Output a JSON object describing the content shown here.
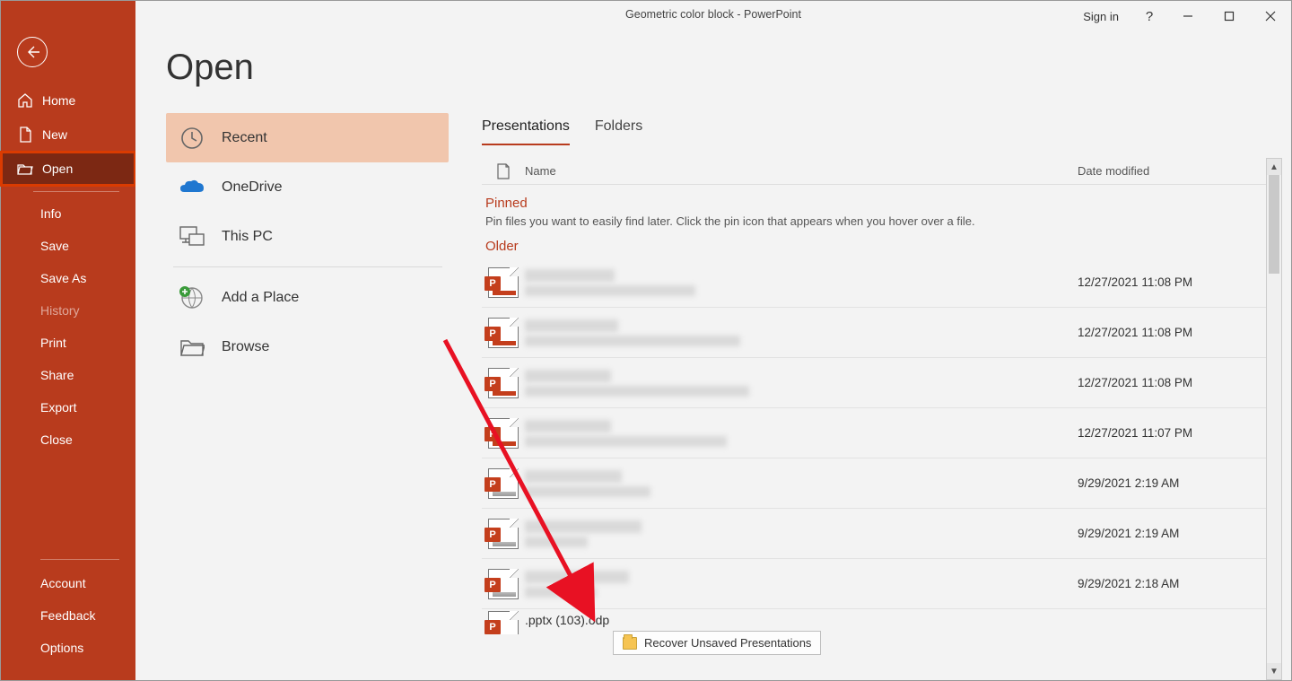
{
  "window": {
    "title": "Geometric color block  -  PowerPoint",
    "sign_in": "Sign in"
  },
  "page": {
    "title": "Open"
  },
  "sidebar": {
    "home": "Home",
    "new": "New",
    "open": "Open",
    "info": "Info",
    "save": "Save",
    "save_as": "Save As",
    "history": "History",
    "print": "Print",
    "share": "Share",
    "export": "Export",
    "close": "Close",
    "account": "Account",
    "feedback": "Feedback",
    "options": "Options"
  },
  "places": {
    "recent": "Recent",
    "onedrive": "OneDrive",
    "this_pc": "This PC",
    "add_place": "Add a Place",
    "browse": "Browse"
  },
  "tabs": {
    "presentations": "Presentations",
    "folders": "Folders"
  },
  "list_header": {
    "name": "Name",
    "date": "Date modified"
  },
  "pinned": {
    "heading": "Pinned",
    "hint": "Pin files you want to easily find later. Click the pin icon that appears when you hover over a file."
  },
  "older": {
    "heading": "Older",
    "files": [
      {
        "date": "12/27/2021 11:08 PM",
        "w1": 100,
        "w2": 190,
        "variant": "red"
      },
      {
        "date": "12/27/2021 11:08 PM",
        "w1": 104,
        "w2": 240,
        "variant": "red"
      },
      {
        "date": "12/27/2021 11:08 PM",
        "w1": 96,
        "w2": 250,
        "variant": "red"
      },
      {
        "date": "12/27/2021 11:07 PM",
        "w1": 96,
        "w2": 225,
        "variant": "red"
      },
      {
        "date": "9/29/2021 2:19 AM",
        "w1": 108,
        "w2": 140,
        "variant": "gray"
      },
      {
        "date": "9/29/2021 2:19 AM",
        "w1": 130,
        "w2": 70,
        "variant": "gray"
      },
      {
        "date": "9/29/2021 2:18 AM",
        "w1": 116,
        "w2": 80,
        "variant": "gray"
      }
    ],
    "partial_name": ".pptx (103).odp"
  },
  "recover_button": "Recover Unsaved Presentations"
}
